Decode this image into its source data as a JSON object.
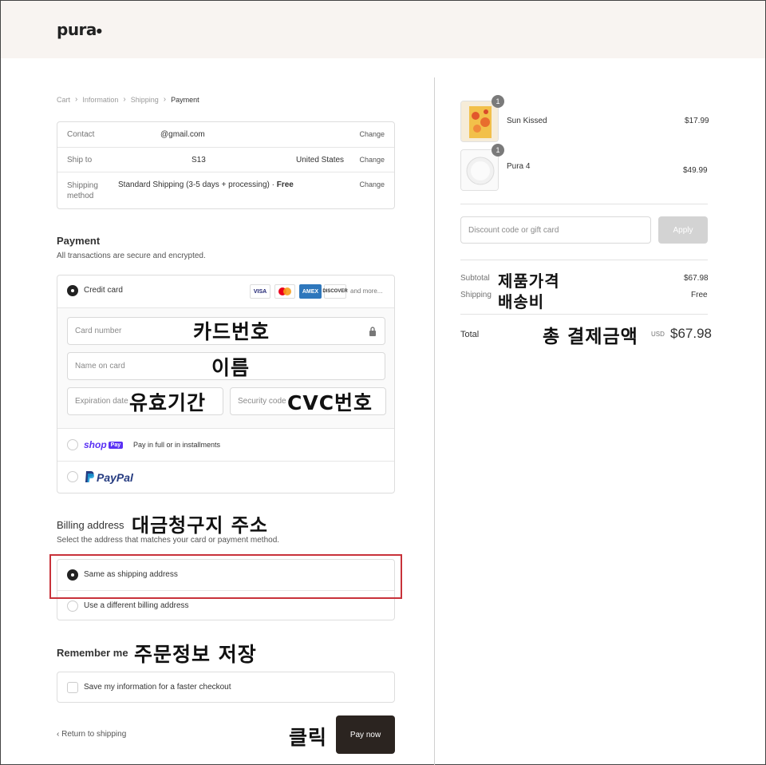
{
  "brand": {
    "name": "pura",
    "dot": "●"
  },
  "breadcrumb": {
    "items": [
      "Cart",
      "Information",
      "Shipping",
      "Payment"
    ],
    "separator": "›"
  },
  "review": {
    "contact_label": "Contact",
    "contact_value": "@gmail.com",
    "ship_label": "Ship to",
    "ship_value": "S13",
    "ship_country": "United States",
    "method_label_1": "Shipping",
    "method_label_2": "method",
    "method_value": "Standard Shipping (3-5 days + processing) · ",
    "method_price": "Free",
    "change_label": "Change"
  },
  "payment": {
    "title": "Payment",
    "subtitle": "All transactions are secure and encrypted.",
    "credit_card_label": "Credit card",
    "card_brands": [
      "VISA",
      "MC",
      "AMEX",
      "DISCOVER"
    ],
    "and_more": "and more...",
    "card_number_placeholder": "Card number",
    "name_placeholder": "Name on card",
    "expiry_placeholder": "Expiration date",
    "security_placeholder": "Security code",
    "shoppay_logo_text": "shop",
    "shoppay_pay": "Pay",
    "shoppay_label": "Pay in full or in installments",
    "paypal_label": "PayPal"
  },
  "annotations": {
    "card_number": "카드번호",
    "name": "이름",
    "expiry": "유효기간",
    "cvc": "CVC번호",
    "billing": "대금청구지 주소",
    "remember": "주문정보 저장",
    "click": "클릭",
    "subtotal": "제품가격",
    "shipping": "배송비",
    "total": "총 결제금액"
  },
  "billing": {
    "title": "Billing address",
    "subtitle": "Select the address that matches your card or payment method.",
    "same_label": "Same as shipping address",
    "different_label": "Use a different billing address"
  },
  "remember": {
    "title": "Remember me",
    "save_label": "Save my information for a faster checkout"
  },
  "footer": {
    "return_label": "‹ Return to shipping",
    "pay_label": "Pay now"
  },
  "cart": {
    "items": [
      {
        "name": "Sun Kissed",
        "qty": "1",
        "price": "$17.99"
      },
      {
        "name": "Pura 4",
        "qty": "1",
        "price": "$49.99"
      }
    ],
    "discount_placeholder": "Discount code or gift card",
    "apply_label": "Apply",
    "subtotal_label": "Subtotal",
    "subtotal_value": "$67.98",
    "shipping_label": "Shipping",
    "shipping_value": "Free",
    "total_label": "Total",
    "currency": "USD",
    "total_value": "$67.98"
  },
  "colors": {
    "header_bg": "#f8f4f1",
    "pay_button": "#2b2420",
    "highlight": "#c8323a",
    "shop_pay": "#5a31f4",
    "paypal_dark": "#253b80",
    "paypal_light": "#179bd7"
  }
}
